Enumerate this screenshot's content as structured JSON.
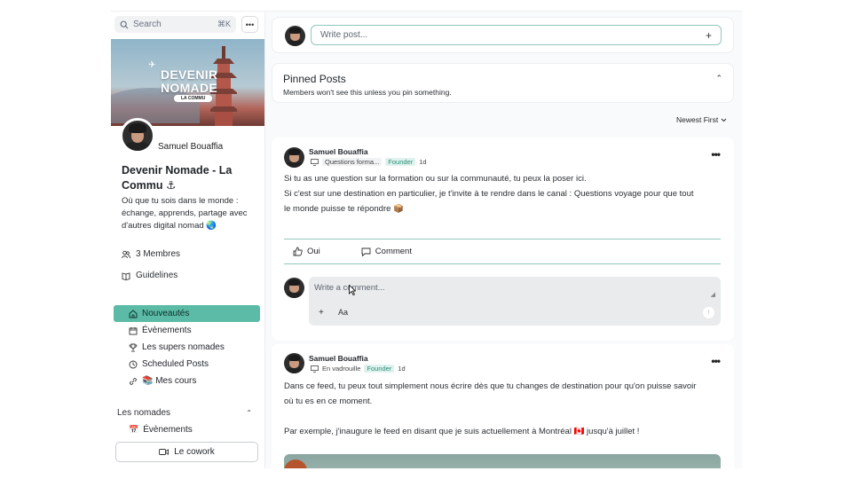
{
  "sidebar": {
    "search_placeholder": "Search",
    "search_shortcut": "⌘K",
    "more_label": "•••",
    "banner": {
      "line1": "DEVENIR",
      "line2": "NOMADE",
      "tag": "LA COMMU"
    },
    "owner_name": "Samuel Bouaffia",
    "community_title": "Devenir Nomade - La Commu ⚓",
    "community_description": "Où que tu sois dans le monde : échange, apprends, partage avec d'autres digital nomad 🌏",
    "members": "3 Membres",
    "guidelines": "Guidelines",
    "nav": [
      {
        "label": "Nouveautés",
        "icon": "home-icon",
        "active": true
      },
      {
        "label": "Évènements",
        "icon": "calendar-icon",
        "active": false
      },
      {
        "label": "Les supers nomades",
        "icon": "trophy-icon",
        "active": false
      },
      {
        "label": "Scheduled Posts",
        "icon": "clock-icon",
        "active": false
      },
      {
        "label": "📚 Mes cours",
        "icon": "link-icon",
        "active": false
      }
    ],
    "group": {
      "title": "Les nomades",
      "items": [
        {
          "label": "Évènements",
          "icon": "calendar-emoji-icon"
        }
      ]
    },
    "cowork_label": "Le cowork"
  },
  "composer": {
    "placeholder": "Write post...",
    "plus": "+"
  },
  "pinned": {
    "title": "Pinned Posts",
    "subtitle": "Members won't see this unless you pin something."
  },
  "sort_label": "Newest First",
  "posts": [
    {
      "author": "Samuel Bouaffia",
      "channel": "Questions forma...",
      "badge": "Founder",
      "time": "1d",
      "lines": [
        "Si tu as une question sur la formation ou sur la communauté, tu peux la poser ici.",
        "Si c'est sur une destination en particulier, je t'invite à te rendre dans le canal : Questions voyage pour que tout",
        "le monde puisse te répondre 📦"
      ],
      "like_label": "Oui",
      "comment_label": "Comment",
      "comment_placeholder": "Write a comment...",
      "comment_plus": "+",
      "comment_format": "Aa"
    },
    {
      "author": "Samuel Bouaffia",
      "channel": "En vadrouille",
      "badge": "Founder",
      "time": "1d",
      "lines": [
        "Dans ce feed, tu peux tout simplement nous écrire dès que tu changes de destination pour qu'on puisse savoir",
        "où tu es en ce moment.",
        "",
        "Par exemple, j'inaugure le feed en disant que je suis actuellement à Montréal 🇨🇦 jusqu'à juillet !"
      ]
    }
  ],
  "colors": {
    "accent": "#5bbba6",
    "accent_border": "#8fc8bc",
    "badge_bg": "#dff2ee"
  }
}
